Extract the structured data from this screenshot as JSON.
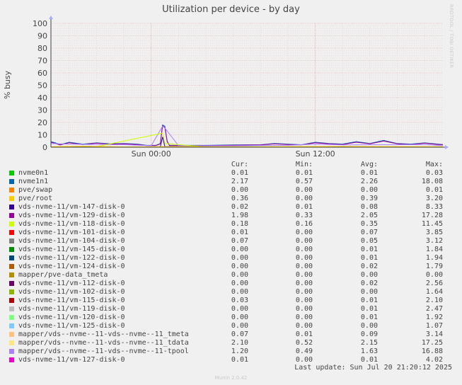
{
  "side_label": "RRDTOOL / TOBI OETIKER",
  "last_update": "Last update: Sun Jul 20 21:20:12 2025",
  "munin_version": "Munin 2.0.42",
  "legend_headers": {
    "cur": "Cur:",
    "min": "Min:",
    "avg": "Avg:",
    "max": "Max:"
  },
  "legend": [
    {
      "name": "nvme0n1",
      "color": "#00cc00",
      "cur": "0.01",
      "min": "0.01",
      "avg": "0.01",
      "max": "0.03"
    },
    {
      "name": "nvme1n1",
      "color": "#0066b3",
      "cur": "2.17",
      "min": "0.57",
      "avg": "2.26",
      "max": "18.08"
    },
    {
      "name": "pve/swap",
      "color": "#ff8000",
      "cur": "0.00",
      "min": "0.00",
      "avg": "0.00",
      "max": "0.01"
    },
    {
      "name": "pve/root",
      "color": "#ffcc00",
      "cur": "0.36",
      "min": "0.00",
      "avg": "0.39",
      "max": "3.20"
    },
    {
      "name": "vds-nvme-11/vm-147-disk-0",
      "color": "#330099",
      "cur": "0.02",
      "min": "0.01",
      "avg": "0.08",
      "max": "8.33"
    },
    {
      "name": "vds-nvme-11/vm-129-disk-0",
      "color": "#990099",
      "cur": "1.98",
      "min": "0.33",
      "avg": "2.05",
      "max": "17.28"
    },
    {
      "name": "vds-nvme-11/vm-118-disk-0",
      "color": "#ccff00",
      "cur": "0.18",
      "min": "0.16",
      "avg": "0.35",
      "max": "11.45"
    },
    {
      "name": "vds-nvme-11/vm-101-disk-0",
      "color": "#ff0000",
      "cur": "0.01",
      "min": "0.00",
      "avg": "0.07",
      "max": "3.85"
    },
    {
      "name": "vds-nvme-11/vm-104-disk-0",
      "color": "#808080",
      "cur": "0.07",
      "min": "0.00",
      "avg": "0.05",
      "max": "3.12"
    },
    {
      "name": "vds-nvme-11/vm-145-disk-0",
      "color": "#008f00",
      "cur": "0.00",
      "min": "0.00",
      "avg": "0.01",
      "max": "1.84"
    },
    {
      "name": "vds-nvme-11/vm-122-disk-0",
      "color": "#00487d",
      "cur": "0.00",
      "min": "0.00",
      "avg": "0.01",
      "max": "1.94"
    },
    {
      "name": "vds-nvme-11/vm-124-disk-0",
      "color": "#b35a00",
      "cur": "0.00",
      "min": "0.00",
      "avg": "0.02",
      "max": "1.79"
    },
    {
      "name": "mapper/pve-data_tmeta",
      "color": "#b38f00",
      "cur": "0.00",
      "min": "0.00",
      "avg": "0.00",
      "max": "0.00"
    },
    {
      "name": "vds-nvme-11/vm-112-disk-0",
      "color": "#6b006b",
      "cur": "0.00",
      "min": "0.00",
      "avg": "0.02",
      "max": "2.56"
    },
    {
      "name": "vds-nvme-11/vm-102-disk-0",
      "color": "#8fb300",
      "cur": "0.00",
      "min": "0.00",
      "avg": "0.00",
      "max": "1.64"
    },
    {
      "name": "vds-nvme-11/vm-115-disk-0",
      "color": "#b30000",
      "cur": "0.03",
      "min": "0.00",
      "avg": "0.01",
      "max": "2.10"
    },
    {
      "name": "vds-nvme-11/vm-119-disk-0",
      "color": "#bebebe",
      "cur": "0.00",
      "min": "0.00",
      "avg": "0.01",
      "max": "2.47"
    },
    {
      "name": "vds-nvme-11/vm-120-disk-0",
      "color": "#80ff80",
      "cur": "0.00",
      "min": "0.00",
      "avg": "0.01",
      "max": "1.92"
    },
    {
      "name": "vds-nvme-11/vm-125-disk-0",
      "color": "#80c9ff",
      "cur": "0.00",
      "min": "0.00",
      "avg": "0.00",
      "max": "1.07"
    },
    {
      "name": "mapper/vds--nvme--11-vds--nvme--11_tmeta",
      "color": "#ffc080",
      "cur": "0.07",
      "min": "0.01",
      "avg": "0.09",
      "max": "3.14"
    },
    {
      "name": "mapper/vds--nvme--11-vds--nvme--11_tdata",
      "color": "#ffe680",
      "cur": "2.10",
      "min": "0.52",
      "avg": "2.15",
      "max": "17.25"
    },
    {
      "name": "mapper/vds--nvme--11-vds--nvme--11-tpool",
      "color": "#aa80ff",
      "cur": "1.20",
      "min": "0.49",
      "avg": "1.63",
      "max": "16.88"
    },
    {
      "name": "vds-nvme-11/vm-127-disk-0",
      "color": "#ee00cc",
      "cur": "0.01",
      "min": "0.00",
      "avg": "0.01",
      "max": "4.02"
    }
  ],
  "chart_data": {
    "type": "line",
    "title": "Utilization per device - by day",
    "ylabel": "% busy",
    "xlabel": "",
    "ylim": [
      0,
      100
    ],
    "yticks": [
      0,
      10,
      20,
      30,
      40,
      50,
      60,
      70,
      80,
      90,
      100
    ],
    "xlim": [
      "Sat 16:40",
      "Sun 21:20"
    ],
    "xticks": [
      {
        "label": "Sun 00:00",
        "time": "Sun 00:00"
      },
      {
        "label": "Sun 12:00",
        "time": "Sun 12:00"
      }
    ],
    "grid": true,
    "series": [
      {
        "name": "nvme1n1",
        "color": "#0066b3",
        "times": [
          "Sat 16:40",
          "Sat 17:00",
          "Sat 17:20",
          "Sat 18:00",
          "Sat 19:00",
          "Sat 20:00",
          "Sat 21:00",
          "Sat 22:00",
          "Sat 23:00",
          "Sat 23:40",
          "Sun 00:20",
          "Sun 00:40",
          "Sun 00:50",
          "Sun 01:00",
          "Sun 01:10",
          "Sun 01:20",
          "Sun 02:00",
          "Sun 04:00",
          "Sun 06:00",
          "Sun 08:00",
          "Sun 09:00",
          "Sun 10:00",
          "Sun 11:00",
          "Sun 12:00",
          "Sun 13:00",
          "Sun 14:00",
          "Sun 15:00",
          "Sun 16:00",
          "Sun 17:00",
          "Sun 18:00",
          "Sun 19:00",
          "Sun 20:00",
          "Sun 21:00",
          "Sun 21:20"
        ],
        "values": [
          4.5,
          3.5,
          2.0,
          4.0,
          2.5,
          3.5,
          2.8,
          3.0,
          2.5,
          1.5,
          1.5,
          3.0,
          18.0,
          17.0,
          5.0,
          1.5,
          1.5,
          1.5,
          1.8,
          2.0,
          3.0,
          2.5,
          2.0,
          4.0,
          3.0,
          2.5,
          4.5,
          3.0,
          5.5,
          3.0,
          2.5,
          3.5,
          2.5,
          2.2
        ]
      },
      {
        "name": "vds-nvme-11/vm-129-disk-0",
        "color": "#990099",
        "times": [
          "Sat 16:40",
          "Sat 17:00",
          "Sat 17:20",
          "Sat 18:00",
          "Sat 19:00",
          "Sat 20:00",
          "Sat 21:00",
          "Sat 22:00",
          "Sat 23:00",
          "Sat 23:40",
          "Sun 00:20",
          "Sun 00:40",
          "Sun 00:50",
          "Sun 01:00",
          "Sun 01:10",
          "Sun 01:20",
          "Sun 02:00",
          "Sun 04:00",
          "Sun 06:00",
          "Sun 08:00",
          "Sun 09:00",
          "Sun 10:00",
          "Sun 11:00",
          "Sun 12:00",
          "Sun 13:00",
          "Sun 14:00",
          "Sun 15:00",
          "Sun 16:00",
          "Sun 17:00",
          "Sun 18:00",
          "Sun 19:00",
          "Sun 20:00",
          "Sun 21:00",
          "Sun 21:20"
        ],
        "values": [
          4.0,
          3.0,
          1.8,
          3.6,
          2.2,
          3.2,
          2.5,
          2.7,
          2.2,
          1.3,
          1.3,
          2.7,
          17.3,
          16.0,
          4.5,
          1.3,
          1.3,
          1.3,
          1.6,
          1.8,
          2.7,
          2.2,
          1.8,
          3.6,
          2.7,
          2.2,
          4.0,
          2.7,
          5.0,
          2.7,
          2.2,
          3.2,
          2.2,
          2.0
        ]
      },
      {
        "name": "mapper/vds--nvme--11-vds--nvme--11-tpool",
        "color": "#aa80ff",
        "times": [
          "Sat 16:40",
          "Sat 18:00",
          "Sat 20:00",
          "Sat 22:00",
          "Sun 00:00",
          "Sun 00:50",
          "Sun 01:00",
          "Sun 02:00",
          "Sun 06:00",
          "Sun 10:00",
          "Sun 12:00",
          "Sun 14:00",
          "Sun 16:00",
          "Sun 18:00",
          "Sun 20:00",
          "Sun 21:20"
        ],
        "values": [
          3.0,
          2.5,
          2.2,
          2.0,
          1.2,
          16.9,
          15.5,
          1.2,
          1.2,
          1.5,
          2.5,
          1.8,
          2.0,
          2.0,
          2.2,
          1.2
        ]
      },
      {
        "name": "vds-nvme-11/vm-118-disk-0",
        "color": "#ccff00",
        "times": [
          "Sat 16:40",
          "Sat 20:00",
          "Sun 00:50",
          "Sun 01:00",
          "Sun 04:00",
          "Sun 12:00",
          "Sun 21:20"
        ],
        "values": [
          0.3,
          0.4,
          11.4,
          3.0,
          0.3,
          0.5,
          0.2
        ]
      },
      {
        "name": "vds-nvme-11/vm-147-disk-0",
        "color": "#330099",
        "times": [
          "Sat 16:40",
          "Sun 00:40",
          "Sun 00:50",
          "Sun 01:00",
          "Sun 21:20"
        ],
        "values": [
          0.1,
          0.1,
          8.3,
          0.5,
          0.0
        ]
      },
      {
        "name": "pve/root",
        "color": "#ffcc00",
        "times": [
          "Sat 16:40",
          "Sat 19:00",
          "Sat 22:00",
          "Sun 02:00",
          "Sun 08:00",
          "Sun 14:00",
          "Sun 21:20"
        ],
        "values": [
          0.4,
          0.8,
          0.3,
          0.5,
          0.3,
          0.6,
          0.4
        ]
      }
    ]
  }
}
